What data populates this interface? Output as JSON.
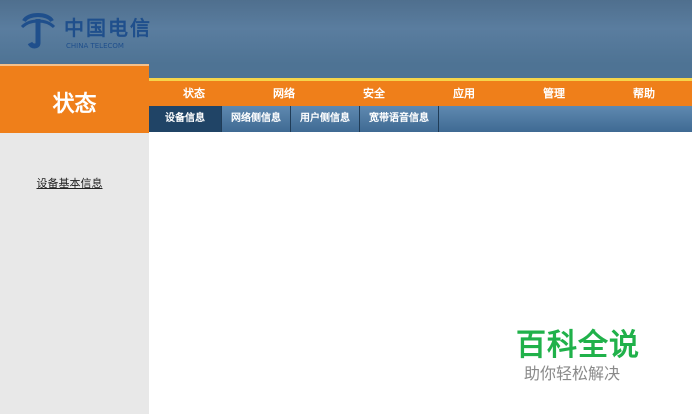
{
  "header": {
    "logo_cn": "中国电信",
    "logo_en": "CHINA TELECOM",
    "brand_color": "#1f4f8c",
    "bar_color": "#4f6f8e"
  },
  "left_panel": {
    "title": "状态",
    "link": "设备基本信息",
    "accent": "#ef7f1a",
    "bg": "#e8e8e8"
  },
  "nav": {
    "items": [
      "状态",
      "网络",
      "安全",
      "应用",
      "管理",
      "帮助"
    ],
    "sub_items": [
      "设备信息",
      "网络侧信息",
      "用户侧信息",
      "宽带语音信息"
    ]
  },
  "watermark": {
    "title": "百科全说",
    "subtitle": "助你轻松解决"
  }
}
